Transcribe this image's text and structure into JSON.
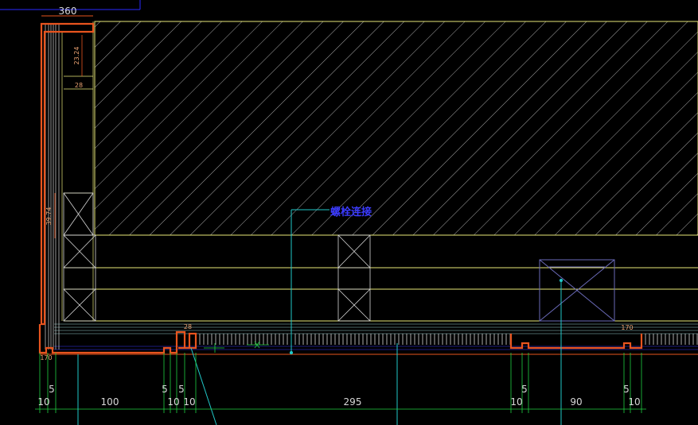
{
  "colors": {
    "background": "#000000",
    "profile": "#e8541e",
    "outline": "#e8e878",
    "hatch": "#d8d8d8",
    "dimension": "#20d040",
    "leader": "#20c8c8",
    "annotation": "#3b3bff"
  },
  "labels": {
    "top_dim": "360",
    "callout": "螺栓连接",
    "vert_dim_upper": "23.24",
    "vert_dim_lower": "39.74",
    "small_tag_upper": "28",
    "small_tag_left": "170",
    "small_tag_right": "170",
    "small_tag_mid": "28"
  },
  "bottom_dims": [
    {
      "id": "d5a",
      "text": "5"
    },
    {
      "id": "d10a",
      "text": "10"
    },
    {
      "id": "d100",
      "text": "100"
    },
    {
      "id": "d5b",
      "text": "5"
    },
    {
      "id": "d10b",
      "text": "10"
    },
    {
      "id": "d5c",
      "text": "5"
    },
    {
      "id": "d10c",
      "text": "10"
    },
    {
      "id": "d295",
      "text": "295"
    },
    {
      "id": "d10d",
      "text": "10"
    },
    {
      "id": "d5d",
      "text": "5"
    },
    {
      "id": "d90",
      "text": "90"
    },
    {
      "id": "d5e",
      "text": "5"
    },
    {
      "id": "d10e",
      "text": "10"
    }
  ]
}
